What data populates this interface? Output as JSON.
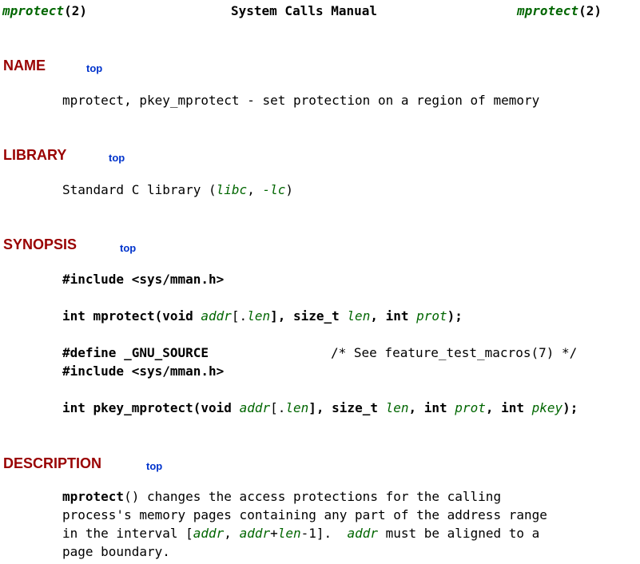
{
  "header": {
    "left_name": "mprotect",
    "left_section": "(2)",
    "center": "System Calls Manual",
    "right_name": "mprotect",
    "right_section": "(2)"
  },
  "sections": {
    "name": {
      "title": "NAME",
      "top_link": "top"
    },
    "library": {
      "title": "LIBRARY",
      "top_link": "top"
    },
    "synopsis": {
      "title": "SYNOPSIS",
      "top_link": "top"
    },
    "description": {
      "title": "DESCRIPTION",
      "top_link": "top"
    }
  },
  "name_text": "mprotect, pkey_mprotect - set protection on a region of memory",
  "library": {
    "prefix": "Standard C library (",
    "libc": "libc",
    "sep": ", ",
    "lc": "-lc",
    "suffix": ")"
  },
  "synopsis": {
    "include1": "#include <sys/mman.h>",
    "proto1": {
      "start": "int mprotect(void ",
      "addr": "addr",
      "br_open": "[.",
      "len_var": "len",
      "br_close": "], size_t ",
      "len": "len",
      "comma": ", int ",
      "prot": "prot",
      "end": ");"
    },
    "define": "#define _GNU_SOURCE",
    "define_comment": "/* See feature_test_macros(7) */",
    "include2": "#include <sys/mman.h>",
    "proto2": {
      "start": "int pkey_mprotect(void ",
      "addr": "addr",
      "br_open": "[.",
      "len_var": "len",
      "br_close": "], size_t ",
      "len": "len",
      "comma1": ", int ",
      "prot": "prot",
      "comma2": ", int ",
      "pkey": "pkey",
      "end": ");"
    }
  },
  "description": {
    "l1_fn": "mprotect",
    "l1_rest": "() changes the access protections for the calling",
    "l2": "process's memory pages containing any part of the address range",
    "l3_a": "in the interval [",
    "l3_addr": "addr",
    "l3_b": ", ",
    "l3_addr2": "addr",
    "l3_plus": "+",
    "l3_len": "len",
    "l3_c": "-1].  ",
    "l3_addr3": "addr",
    "l3_d": " must be aligned to a",
    "l4": "page boundary."
  }
}
